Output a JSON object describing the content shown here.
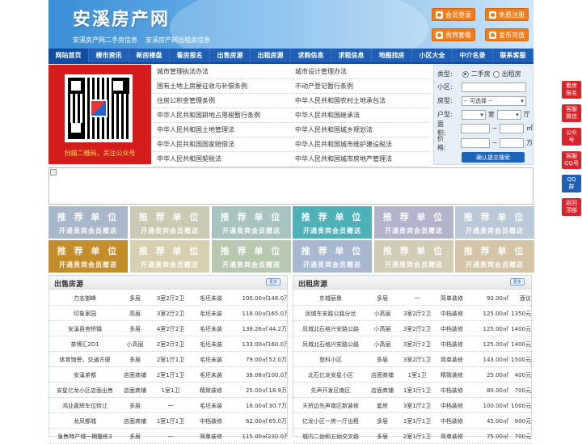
{
  "header": {
    "title": "安溪房产网",
    "subtitle": "安溪房产网二手房信息    安溪房产网出租房信息",
    "buttons": [
      "会员登录",
      "免费注册",
      "贵宾套餐",
      "金币充值"
    ]
  },
  "nav": [
    "网站首页",
    "楼市资讯",
    "新房楼盘",
    "看房报名",
    "出售房源",
    "出租房源",
    "求购信息",
    "求租信息",
    "地图找房",
    "小区大全",
    "中介名录",
    "联系客服"
  ],
  "qr": {
    "caption": "扫描二维码，关注公众号"
  },
  "links_left": [
    "城市管理执法办法",
    "国有土地上房屋征收与补偿条例",
    "住房公积金管理条例",
    "中华人民共和国耕地占用税暂行条例",
    "中华人民共和国土地管理法",
    "中华人民共和国国家赔偿法",
    "中华人民共和国契税法"
  ],
  "links_right": [
    "城市设计管理办法",
    "不动产登记暂行条例",
    "中华人民共和国农村土地承包法",
    "中华人民共和国继承法",
    "中华人民共和国城乡规划法",
    "中华人民共和国城市维护建设税法",
    "中华人民共和国城市房地产管理法"
  ],
  "search": {
    "type_label": "类型:",
    "opt1": "二手房",
    "opt2": "出租房",
    "area_label": "小区:",
    "house_label": "房型:",
    "house_sel": "-- 可选择 --",
    "layout_label": "户型:",
    "room": "室",
    "hall": "厅",
    "size_label": "面积:",
    "size_unit": "㎡",
    "price_label": "价格:",
    "price_unit": "万",
    "tilde": "~",
    "submit": "确认提交搜索"
  },
  "rec": {
    "t1": "推 荐 单 位",
    "t2": "开通贵宾会员赠送"
  },
  "rec_colors": [
    "#a9b8c8",
    "#c9c9b4",
    "#a8c3c0",
    "#4fb1b8",
    "#b3b3cc",
    "#b9c9d8",
    "#c38d2a",
    "#d8cfb0",
    "#b8c8b0",
    "#a8b8d0",
    "#d2cbb6",
    "#d4c4a8"
  ],
  "sale": {
    "title": "出售房源",
    "more": "更多",
    "rows": [
      [
        "力志御峰",
        "多层",
        "3室2厅2卫",
        "毛坯未装",
        "100.00㎡",
        "148.0万"
      ],
      [
        "印象家园",
        "高层",
        "3室2厅2卫",
        "毛坯未装",
        "118.00㎡",
        "165.0万"
      ],
      [
        "安溪县官桥镇",
        "多层",
        "4室2厅2卫",
        "毛坯未装",
        "138.26㎡",
        "44.2万"
      ],
      [
        "茶博汇2D1",
        "小高层",
        "2室2厅2卫",
        "毛坯未装",
        "133.00㎡",
        "160.0万"
      ],
      [
        "体育馆旁，交通方便",
        "多层",
        "2室1厅1卫",
        "毛坯未装",
        "79.00㎡",
        "52.0万"
      ],
      [
        "安溪茶都",
        "店面商铺",
        "2室1厅1卫",
        "毛坯未装",
        "38.08㎡",
        "100.0万"
      ],
      [
        "安星亿龙小区店面出售",
        "店面商铺",
        "1室1卫",
        "精致装修",
        "25.00㎡",
        "18.9万"
      ],
      [
        "鸿业嘉辉车位转让",
        "多层",
        "一",
        "毛坯未装",
        "18.00㎡",
        "30.7万"
      ],
      [
        "龙凤都城",
        "店面商铺",
        "1室1厅1卫",
        "中档装修",
        "62.00㎡",
        "65.0万"
      ],
      [
        "急售特产城一期整栋3",
        "多层",
        "一",
        "简单装修",
        "115.00㎡",
        "230.0万"
      ]
    ]
  },
  "rent": {
    "title": "出租房源",
    "more": "更多",
    "rows": [
      [
        "东城丽景",
        "多层",
        "一",
        "简单装修",
        "93.00㎡",
        "面议"
      ],
      [
        "凤城东安路公路分岔",
        "小高层",
        "3室2厅2卫",
        "中档装修",
        "125.00㎡",
        "1350元"
      ],
      [
        "凤城北石格兴安路公路",
        "小高层",
        "3室2厅2卫",
        "中档装修",
        "125.00㎡",
        "1400元"
      ],
      [
        "凤城北石格兴安路公路",
        "小高层",
        "3室2厅2卫",
        "中档装修",
        "125.00㎡",
        "1400元"
      ],
      [
        "登科小区",
        "多层",
        "3室2厅1卫",
        "简单装修",
        "143.00㎡",
        "1500元"
      ],
      [
        "北石亿龙安星小区",
        "店面商铺",
        "1室1卫",
        "精致装修",
        "25.00㎡",
        "400元"
      ],
      [
        "先声开发区南区",
        "店面商铺",
        "1室1厅1卫",
        "中档装修",
        "80.00㎡",
        "700元"
      ],
      [
        "天桥边先声南区新装修",
        "套房",
        "3室1厅2卫",
        "中档装修",
        "100.00㎡",
        "1000元"
      ],
      [
        "亿龙小区一房一厅出租",
        "多层",
        "1室1厅1卫",
        "中档装修",
        "45.00㎡",
        "900元"
      ],
      [
        "城内二幼和五幼交叉路",
        "多层",
        "2室1厅1卫",
        "简单装修",
        "75.00㎡",
        "700元"
      ]
    ]
  },
  "side": [
    "看房报名",
    "客服微信",
    "公众号",
    "客服QQ号",
    "QQ群",
    "返回顶部"
  ]
}
